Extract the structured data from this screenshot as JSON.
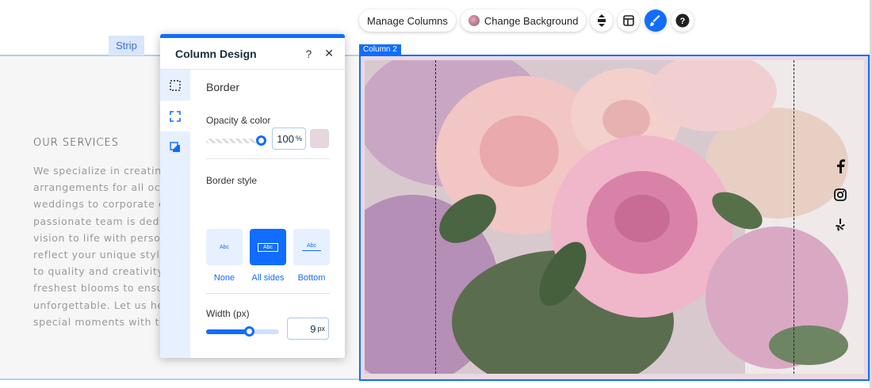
{
  "strip": {
    "tag": "Strip"
  },
  "services": {
    "title": "OUR SERVICES",
    "lines": [
      "We specialize in creating stu",
      "arrangements for all occasio",
      "weddings to corporate event",
      "passionate team is dedicated",
      "vision to life with personalize",
      "reflect your unique style. Wi",
      "to quality and creativity, we",
      "freshest blooms to ensure yo",
      "unforgettable. Let us help yo",
      "special moments with the be"
    ]
  },
  "toolbar": {
    "manage_columns": "Manage Columns",
    "change_background": "Change Background",
    "icons": [
      "arrange-icon",
      "layout-icon",
      "design-brush-icon",
      "help-icon"
    ]
  },
  "column": {
    "tag": "Column 2"
  },
  "panel": {
    "title": "Column Design",
    "help": "?",
    "close": "✕",
    "tabs": [
      "background-tab-icon",
      "border-tab-icon",
      "shadow-tab-icon"
    ],
    "section_title": "Border",
    "opacity": {
      "label": "Opacity & color",
      "value": "100",
      "unit": "%",
      "level": 1.0,
      "color": "#e8d6df"
    },
    "border_style": {
      "label": "Border style",
      "sample": "Abc",
      "options": [
        "None",
        "All sides",
        "Bottom"
      ],
      "selected": "All sides"
    },
    "width": {
      "label": "Width (px)",
      "value": "9",
      "unit": "px",
      "level": 0.6
    }
  },
  "social": [
    "facebook-icon",
    "instagram-icon",
    "yelp-icon"
  ],
  "colors": {
    "accent": "#116dff",
    "strip_guide": "#b5cdf2"
  }
}
